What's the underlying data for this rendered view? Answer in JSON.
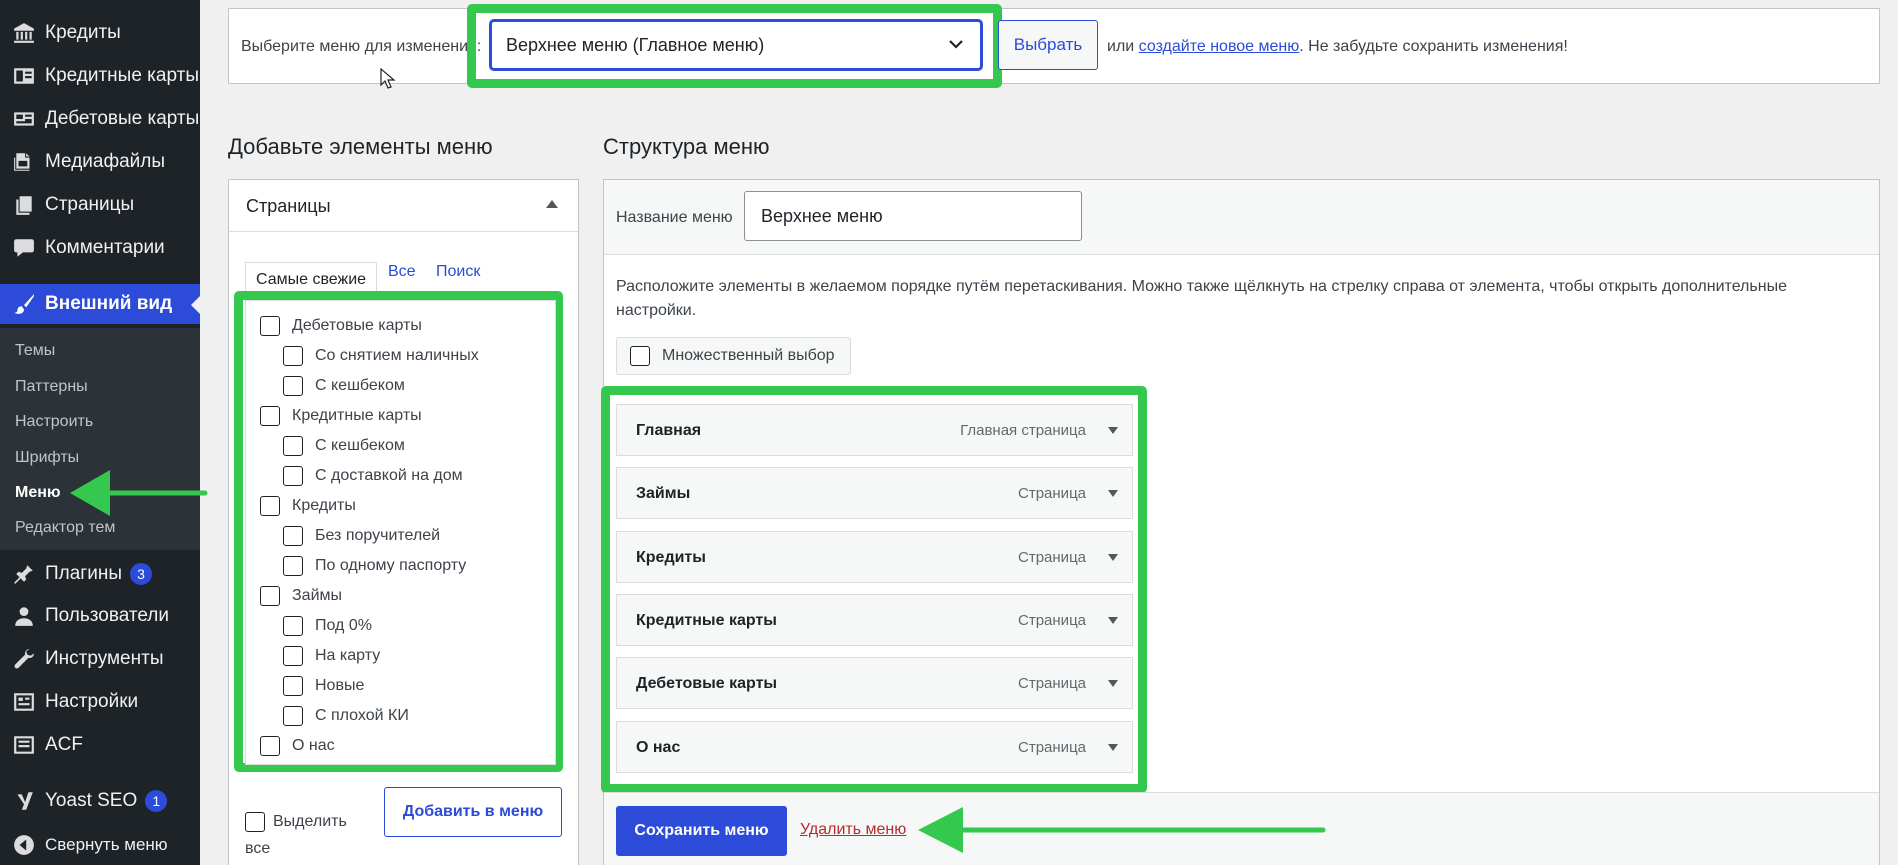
{
  "sidebar": {
    "items": [
      {
        "label": "Кредиты",
        "icon": "bank-icon"
      },
      {
        "label": "Кредитные карты",
        "icon": "id-card-icon"
      },
      {
        "label": "Дебетовые карты",
        "icon": "card-icon"
      },
      {
        "label": "Медиафайлы",
        "icon": "media-icon"
      },
      {
        "label": "Страницы",
        "icon": "pages-icon"
      },
      {
        "label": "Комментарии",
        "icon": "comment-icon"
      },
      {
        "label": "Внешний вид",
        "icon": "brush-icon"
      },
      {
        "label": "Плагины",
        "icon": "plugin-icon",
        "badge": "3"
      },
      {
        "label": "Пользователи",
        "icon": "user-icon"
      },
      {
        "label": "Инструменты",
        "icon": "wrench-icon"
      },
      {
        "label": "Настройки",
        "icon": "settings-icon"
      },
      {
        "label": "ACF",
        "icon": "acf-icon"
      },
      {
        "label": "Yoast SEO",
        "icon": "yoast-icon",
        "badge": "1"
      },
      {
        "label": "Свернуть меню",
        "icon": "collapse-icon"
      }
    ],
    "submenu": [
      "Темы",
      "Паттерны",
      "Настроить",
      "Шрифты",
      "Меню",
      "Редактор тем"
    ],
    "submenu_current": "Меню"
  },
  "topbar": {
    "label": "Выберите меню для изменения:",
    "selected_menu": "Верхнее меню (Главное меню)",
    "select_button": "Выбрать",
    "or_text": "или",
    "create_link": "создайте новое меню",
    "tail_text": ". Не забудьте сохранить изменения!"
  },
  "left": {
    "heading": "Добавьте элементы меню",
    "panel_title": "Страницы",
    "tabs": [
      "Самые свежие",
      "Все",
      "Поиск"
    ],
    "pages": [
      {
        "label": "Дебетовые карты",
        "level": 0
      },
      {
        "label": "Со снятием наличных",
        "level": 1
      },
      {
        "label": "С кешбеком",
        "level": 1
      },
      {
        "label": "Кредитные карты",
        "level": 0
      },
      {
        "label": "С кешбеком",
        "level": 1
      },
      {
        "label": "С доставкой на дом",
        "level": 1
      },
      {
        "label": "Кредиты",
        "level": 0
      },
      {
        "label": "Без поручителей",
        "level": 1
      },
      {
        "label": "По одному паспорту",
        "level": 1
      },
      {
        "label": "Займы",
        "level": 0
      },
      {
        "label": "Под 0%",
        "level": 1
      },
      {
        "label": "На карту",
        "level": 1
      },
      {
        "label": "Новые",
        "level": 1
      },
      {
        "label": "С плохой КИ",
        "level": 1
      },
      {
        "label": "О нас",
        "level": 0
      }
    ],
    "select_all": "Выделить все",
    "add_button": "Добавить в меню"
  },
  "right": {
    "heading": "Структура меню",
    "name_label": "Название меню",
    "name_value": "Верхнее меню",
    "instructions": "Расположите элементы в желаемом порядке путём перетаскивания. Можно также щёлкнуть на стрелку справа от элемента, чтобы открыть дополнительные настройки.",
    "multi_select": "Множественный выбор",
    "menu_items": [
      {
        "title": "Главная",
        "type": "Главная страница"
      },
      {
        "title": "Займы",
        "type": "Страница"
      },
      {
        "title": "Кредиты",
        "type": "Страница"
      },
      {
        "title": "Кредитные карты",
        "type": "Страница"
      },
      {
        "title": "Дебетовые карты",
        "type": "Страница"
      },
      {
        "title": "О нас",
        "type": "Страница"
      }
    ],
    "save_button": "Сохранить меню",
    "delete_link": "Удалить меню"
  },
  "colors": {
    "highlight": "#34c94e",
    "accent": "#2b4bd8",
    "sidebar_bg": "#1d2327",
    "delete": "#b32d2e"
  }
}
